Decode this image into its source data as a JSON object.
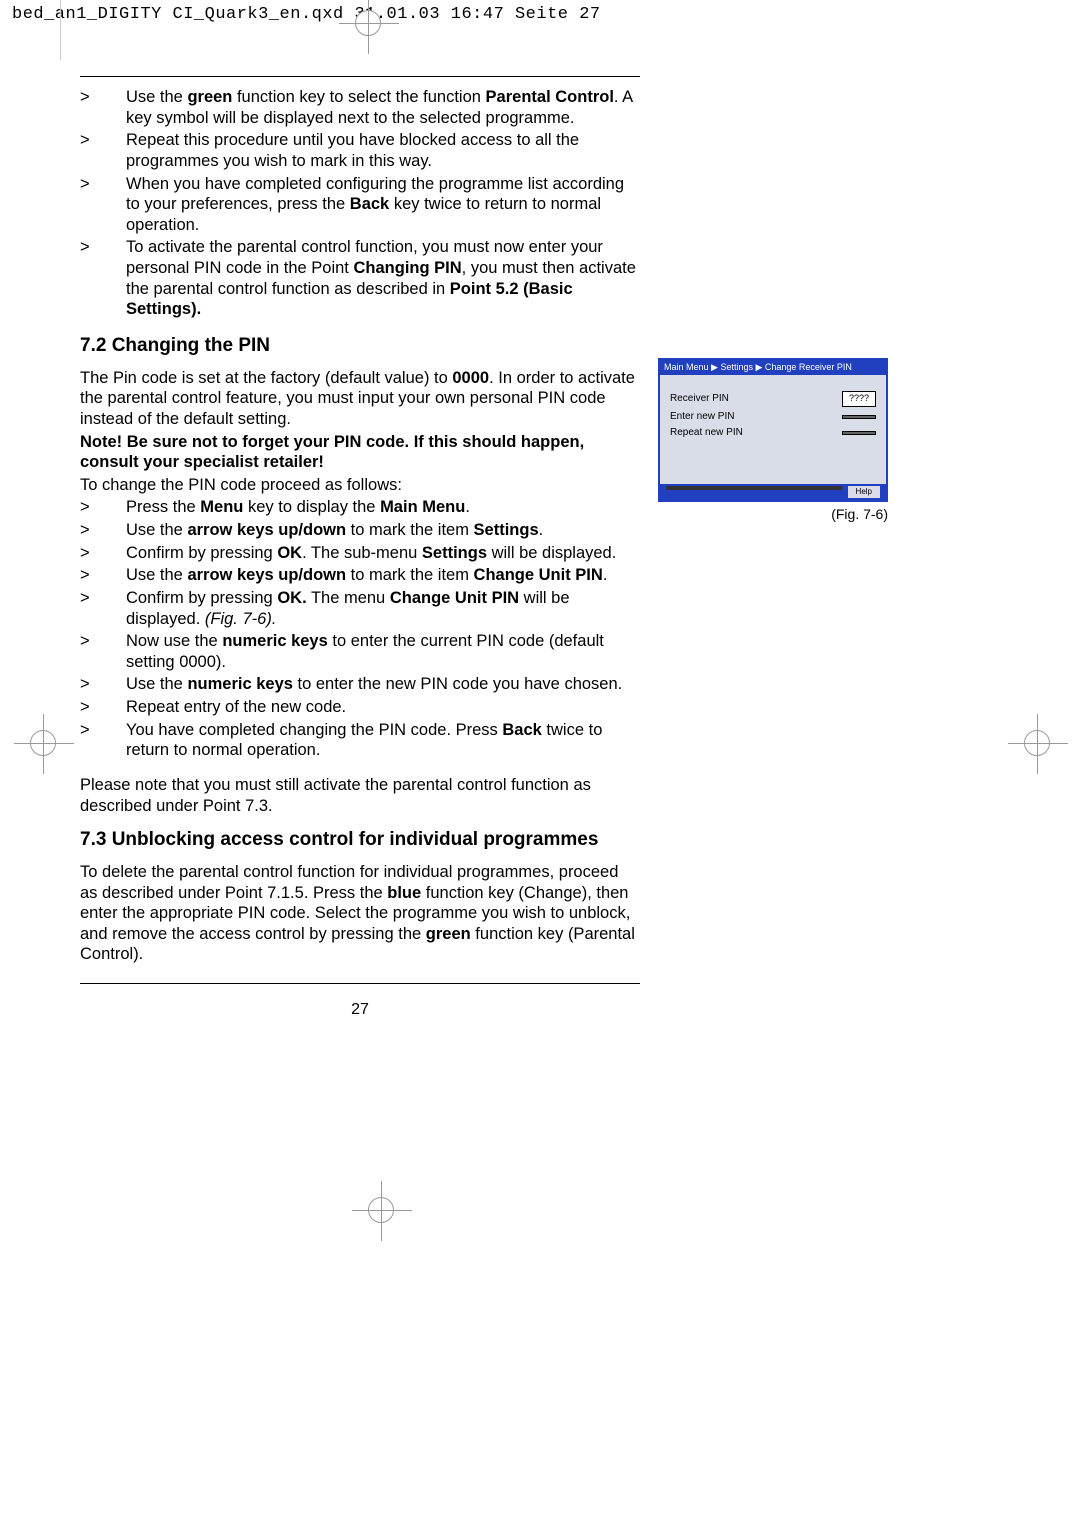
{
  "header": "bed_an1_DIGITY CI_Quark3_en.qxd  31.01.03  16:47  Seite 27",
  "intro_bullets": [
    {
      "text_parts": [
        "Use the ",
        "green",
        " function key to select the function ",
        "Parental Control",
        ".",
        " A key symbol will be displayed next to the selected programme."
      ]
    },
    {
      "text_parts": [
        "Repeat this procedure until you have blocked access to all the programmes you wish to mark in this way."
      ]
    },
    {
      "text_parts": [
        "When you have completed configuring the programme list according to your preferences, press the ",
        "Back",
        " key twice to return to normal operation."
      ]
    },
    {
      "text_parts": [
        "To activate the parental control function, you must now enter your personal PIN code in the Point ",
        "Changing PIN",
        ", you must then activate the parental control function as described in ",
        "Point 5.2 (Basic Settings)."
      ]
    }
  ],
  "sec72": {
    "title": "7.2 Changing the PIN",
    "para1_parts": [
      "The Pin code is set at the factory (default value) to ",
      "0000",
      ". In order to activate the parental control feature, you must input your own personal PIN code instead of the default setting."
    ],
    "note": "Note! Be sure not to forget your PIN code. If this should happen, consult your specialist retailer!",
    "para2": "To change the PIN code proceed as follows:",
    "bullets": [
      [
        "Press the ",
        "Menu",
        " key to display the ",
        "Main Menu",
        "."
      ],
      [
        "Use the ",
        "arrow keys up/down",
        " to mark the item ",
        "Settings",
        "."
      ],
      [
        "Confirm by pressing ",
        "OK",
        ".",
        " The sub-menu ",
        "Settings",
        " will be displayed."
      ],
      [
        "Use the ",
        "arrow keys up/down",
        " to mark the item ",
        "Change Unit PIN",
        "."
      ],
      [
        "Confirm by pressing ",
        "OK.",
        " The menu ",
        "Change Unit PIN",
        " will be displayed. ",
        "(Fig. 7-6)."
      ],
      [
        "Now use the ",
        "numeric keys",
        " to enter the current PIN code (default setting 0000)."
      ],
      [
        "Use the ",
        "numeric keys",
        " to enter the new PIN code you have chosen."
      ],
      [
        "Repeat entry of the new code."
      ],
      [
        "You have completed changing the PIN code. Press ",
        "Back",
        " twice to return to normal operation."
      ]
    ],
    "para3": "Please note that you must still activate the parental control function as described under Point 7.3."
  },
  "sec73": {
    "title": "7.3 Unblocking access control for individual programmes",
    "para_parts": [
      "To delete the parental control function for individual programmes, proceed as described under Point 7.1.5. Press the ",
      "blue",
      " function key (Change), then enter the appropriate PIN code. Select the programme you wish to unblock, and remove the access control by pressing the ",
      "green",
      " function key (Parental Control)."
    ]
  },
  "page_number": "27",
  "figure": {
    "breadcrumb": "Main Menu ▶ Settings ▶ Change Receiver PIN",
    "rows": [
      {
        "label": "Receiver PIN",
        "value": "????",
        "active": true
      },
      {
        "label": "Enter new PIN",
        "value": "",
        "active": false
      },
      {
        "label": "Repeat new PIN",
        "value": "",
        "active": false
      }
    ],
    "help": "Help",
    "caption": "(Fig. 7-6)"
  },
  "bullet_mark": ">"
}
